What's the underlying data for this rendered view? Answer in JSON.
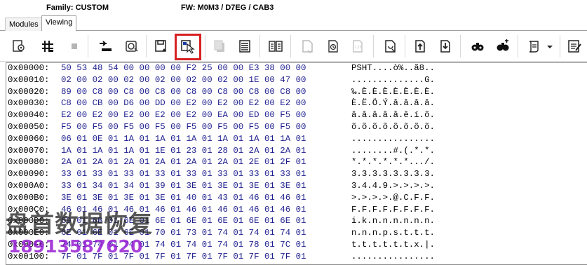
{
  "header": {
    "family": "Family: CUSTOM",
    "fw": "FW: M0M3 / D7EG / CAB3"
  },
  "tabs": [
    {
      "label": "Modules",
      "active": false
    },
    {
      "label": "Viewing",
      "active": true
    }
  ],
  "toolbar": {
    "items": [
      {
        "name": "settings-icon",
        "enabled": true
      },
      {
        "name": "grid-icon",
        "enabled": true
      },
      {
        "name": "stop-icon",
        "enabled": false
      },
      {
        "name": "download-icon",
        "enabled": true
      },
      {
        "name": "drive-icon",
        "enabled": true
      },
      {
        "name": "save-icon",
        "enabled": true
      },
      {
        "name": "pointer-icon",
        "enabled": true,
        "highlighted": true
      },
      {
        "name": "copy-icon",
        "enabled": false
      },
      {
        "name": "stack-icon",
        "enabled": true
      },
      {
        "name": "compare-icon",
        "enabled": true
      },
      {
        "name": "page-icon",
        "enabled": false
      },
      {
        "name": "paste-icon",
        "enabled": true
      },
      {
        "name": "checksum-icon",
        "enabled": false
      },
      {
        "name": "edit-page-icon",
        "enabled": true
      },
      {
        "name": "jump-start-icon",
        "enabled": true
      },
      {
        "name": "jump-end-icon",
        "enabled": true
      },
      {
        "name": "find-icon",
        "enabled": true
      },
      {
        "name": "find-next-icon",
        "enabled": true
      },
      {
        "name": "scroll-icon",
        "enabled": true
      },
      {
        "name": "dropdown-arrow-icon",
        "enabled": true
      },
      {
        "name": "notes-icon",
        "enabled": true
      }
    ]
  },
  "hex_rows": [
    {
      "addr": "0x00000:",
      "hex": "50 53 48 54 00 00 00 00 F2 25 00 00 E3 38 00 00",
      "ascii": "PSHT....ò%..ã8.."
    },
    {
      "addr": "0x00010:",
      "hex": "02 00 02 00 02 00 02 00 02 00 02 00 1E 00 47 00",
      "ascii": "..............G."
    },
    {
      "addr": "0x00020:",
      "hex": "89 00 C8 00 C8 00 C8 00 C8 00 C8 00 C8 00 C8 00",
      "ascii": "‰.È.È.È.È.È.È.È."
    },
    {
      "addr": "0x00030:",
      "hex": "C8 00 CB 00 D6 00 DD 00 E2 00 E2 00 E2 00 E2 00",
      "ascii": "È.Ë.Ö.Ý.â.â.â.â."
    },
    {
      "addr": "0x00040:",
      "hex": "E2 00 E2 00 E2 00 E2 00 E2 00 EA 00 ED 00 F5 00",
      "ascii": "â.â.â.â.â.ê.í.õ."
    },
    {
      "addr": "0x00050:",
      "hex": "F5 00 F5 00 F5 00 F5 00 F5 00 F5 00 F5 00 F5 00",
      "ascii": "õ.õ.õ.õ.õ.õ.õ.õ."
    },
    {
      "addr": "0x00060:",
      "hex": "06 01 0E 01 1A 01 1A 01 1A 01 1A 01 1A 01 1A 01",
      "ascii": "................"
    },
    {
      "addr": "0x00070:",
      "hex": "1A 01 1A 01 1A 01 1E 01 23 01 28 01 2A 01 2A 01",
      "ascii": "........#.(.*.*."
    },
    {
      "addr": "0x00080:",
      "hex": "2A 01 2A 01 2A 01 2A 01 2A 01 2A 01 2E 01 2F 01",
      "ascii": "*.*.*.*.*.*.../."
    },
    {
      "addr": "0x00090:",
      "hex": "33 01 33 01 33 01 33 01 33 01 33 01 33 01 33 01",
      "ascii": "3.3.3.3.3.3.3.3."
    },
    {
      "addr": "0x000A0:",
      "hex": "33 01 34 01 34 01 39 01 3E 01 3E 01 3E 01 3E 01",
      "ascii": "3.4.4.9.>.>.>.>."
    },
    {
      "addr": "0x000B0:",
      "hex": "3E 01 3E 01 3E 01 3E 01 40 01 43 01 46 01 46 01",
      "ascii": ">.>.>.>.@.C.F.F."
    },
    {
      "addr": "0x000C0:",
      "hex": "46 01 46 01 46 01 46 01 46 01 46 01 46 01 46 01",
      "ascii": "F.F.F.F.F.F.F.F."
    },
    {
      "addr": "0x000D0:",
      "hex": "69 01 6B 01 6E 01 6E 01 6E 01 6E 01 6E 01 6E 01",
      "ascii": "i.k.n.n.n.n.n.n."
    },
    {
      "addr": "0x000E0:",
      "hex": "6E 01 6E 01 6E 01 70 01 73 01 74 01 74 01 74 01",
      "ascii": "n.n.n.p.s.t.t.t."
    },
    {
      "addr": "0x000F0:",
      "hex": "74 01 74 01 74 01 74 01 74 01 74 01 78 01 7C 01",
      "ascii": "t.t.t.t.t.t.x.|."
    },
    {
      "addr": "0x00100:",
      "hex": "7F 01 7F 01 7F 01 7F 01 7F 01 7F 01 7F 01 7F 01",
      "ascii": "................"
    }
  ],
  "watermark": {
    "text": "盘首数据恢复",
    "phone": "18913587620"
  },
  "colors": {
    "hex_text": "#1f1f8f",
    "highlight": "#d62020",
    "watermark_phone": "#9620d2"
  }
}
